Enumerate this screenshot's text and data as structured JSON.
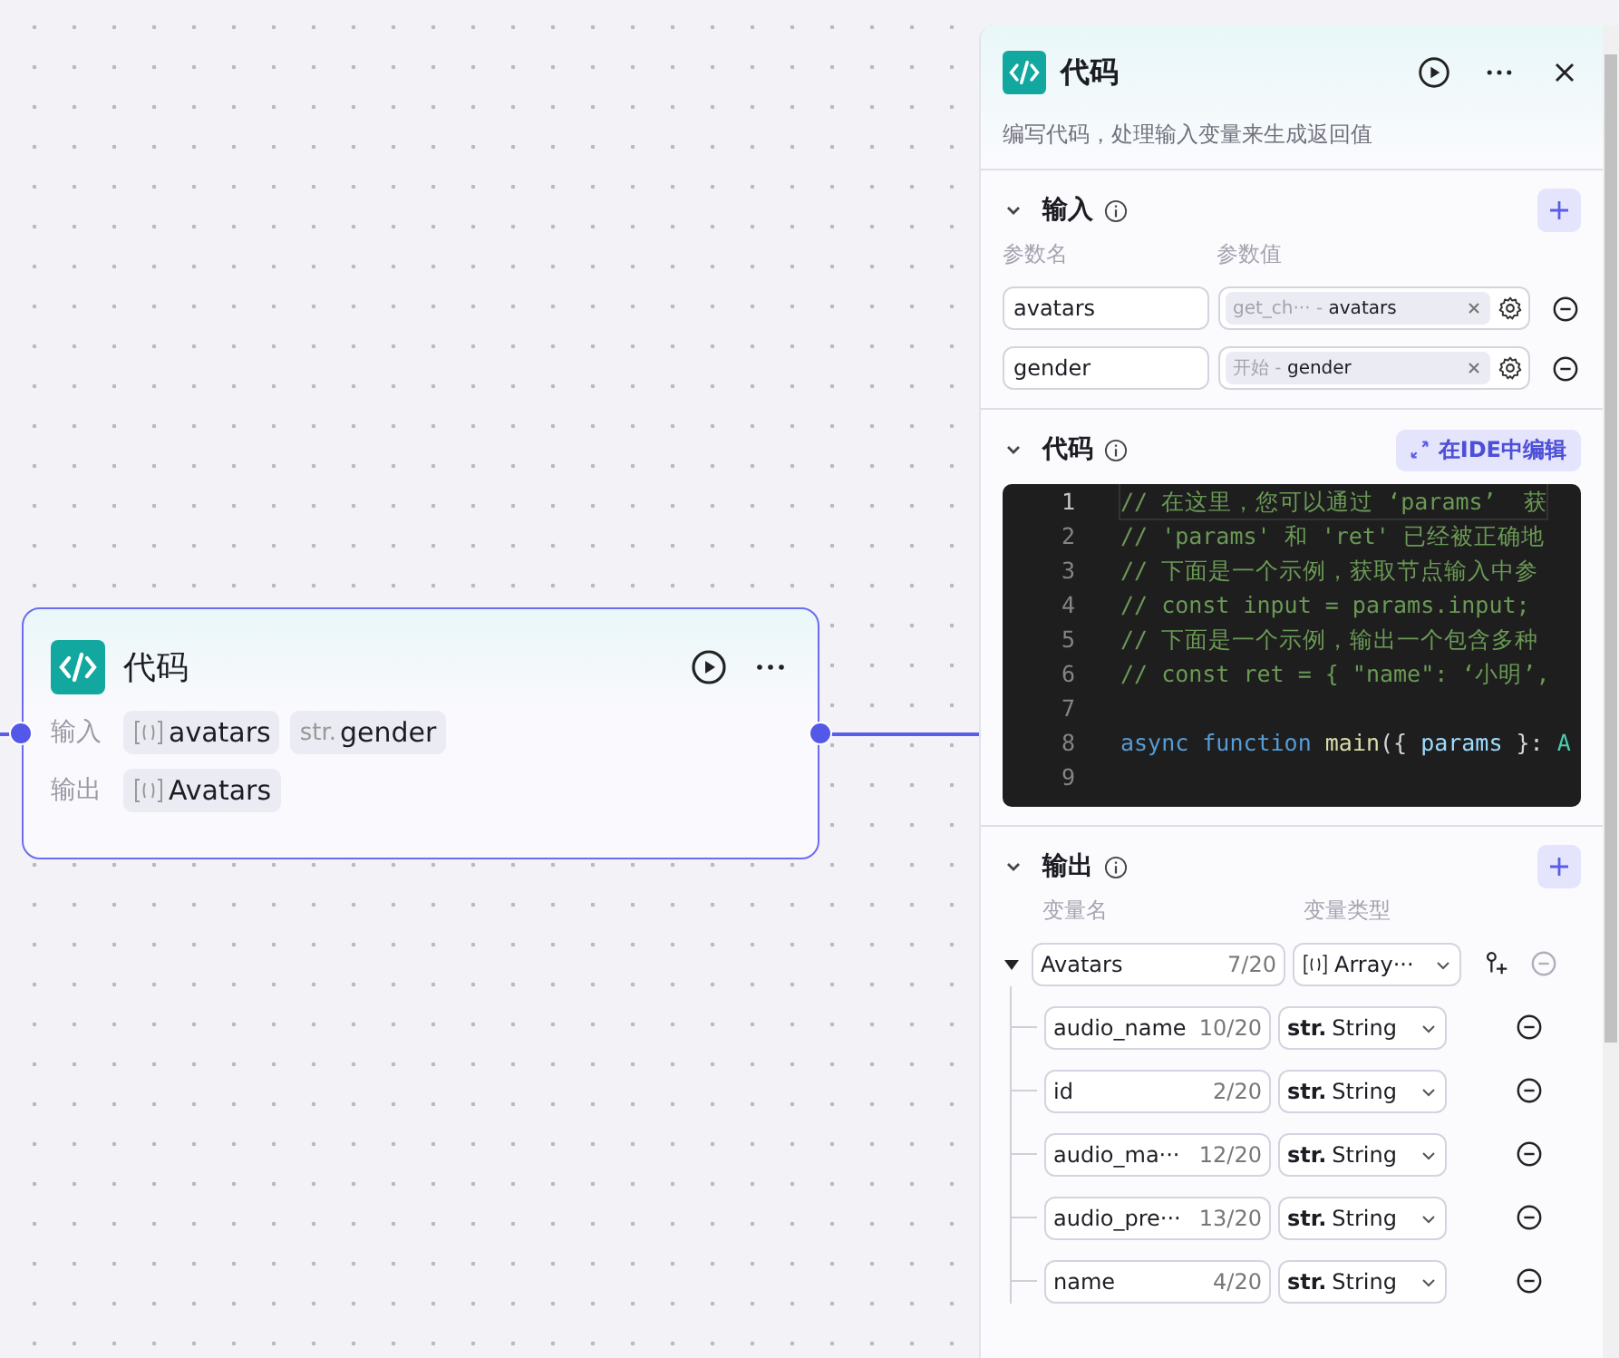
{
  "node": {
    "title": "代码",
    "inputs_label": "输入",
    "outputs_label": "输出",
    "inputs": [
      {
        "kind": "array",
        "name": "avatars"
      },
      {
        "kind": "string",
        "prefix": "str.",
        "name": "gender"
      }
    ],
    "outputs": [
      {
        "kind": "array",
        "name": "Avatars"
      }
    ]
  },
  "panel": {
    "title": "代码",
    "description": "编写代码，处理输入变量来生成返回值",
    "input_section": {
      "title": "输入",
      "expanded": true,
      "col_name": "参数名",
      "col_value": "参数值",
      "params": [
        {
          "name": "avatars",
          "source": "get_ch···",
          "separator": " - ",
          "variable": "avatars"
        },
        {
          "name": "gender",
          "source": "开始",
          "separator": " - ",
          "variable": "gender"
        }
      ]
    },
    "code_section": {
      "title": "代码",
      "expanded": true,
      "ide_button": "在IDE中编辑",
      "lines": [
        {
          "number": "1",
          "tokens": [
            {
              "kind": "comment",
              "text": "// 在这里，您可以通过 ‘params’  获"
            }
          ]
        },
        {
          "number": "2",
          "tokens": [
            {
              "kind": "comment",
              "text": "// 'params' 和 'ret' 已经被正确地"
            }
          ]
        },
        {
          "number": "3",
          "tokens": [
            {
              "kind": "comment",
              "text": "// 下面是一个示例，获取节点输入中参"
            }
          ]
        },
        {
          "number": "4",
          "tokens": [
            {
              "kind": "comment",
              "text": "// const input = params.input;"
            }
          ]
        },
        {
          "number": "5",
          "tokens": [
            {
              "kind": "comment",
              "text": "// 下面是一个示例，输出一个包含多种"
            }
          ]
        },
        {
          "number": "6",
          "tokens": [
            {
              "kind": "comment",
              "text": "// const ret = { \"name\": ‘小明’,"
            }
          ]
        },
        {
          "number": "7"
        },
        {
          "number": "8",
          "tokens": [
            {
              "kind": "keyword",
              "text": "async function "
            },
            {
              "kind": "function",
              "text": "main"
            },
            {
              "kind": "punct",
              "text": "({ "
            },
            {
              "kind": "variable",
              "text": "params"
            },
            {
              "kind": "punct",
              "text": " }: "
            },
            {
              "kind": "type",
              "text": "A"
            }
          ]
        },
        {
          "number": "9"
        }
      ]
    },
    "output_section": {
      "title": "输出",
      "expanded": true,
      "col_name": "变量名",
      "col_type": "变量类型",
      "variables": [
        {
          "name": "Avatars",
          "count": "7/20",
          "type": {
            "kind": "array",
            "label": "Array···"
          },
          "expanded": true,
          "children": [
            {
              "name": "audio_name",
              "count": "10/20",
              "type": {
                "kind": "string",
                "prefix": "str.",
                "label": "String"
              }
            },
            {
              "name": "id",
              "count": "2/20",
              "type": {
                "kind": "string",
                "prefix": "str.",
                "label": "String"
              }
            },
            {
              "name": "audio_ma···",
              "count": "12/20",
              "type": {
                "kind": "string",
                "prefix": "str.",
                "label": "String"
              }
            },
            {
              "name": "audio_pre···",
              "count": "13/20",
              "type": {
                "kind": "string",
                "prefix": "str.",
                "label": "String"
              }
            },
            {
              "name": "name",
              "count": "4/20",
              "type": {
                "kind": "string",
                "prefix": "str.",
                "label": "String"
              }
            }
          ]
        }
      ]
    }
  }
}
